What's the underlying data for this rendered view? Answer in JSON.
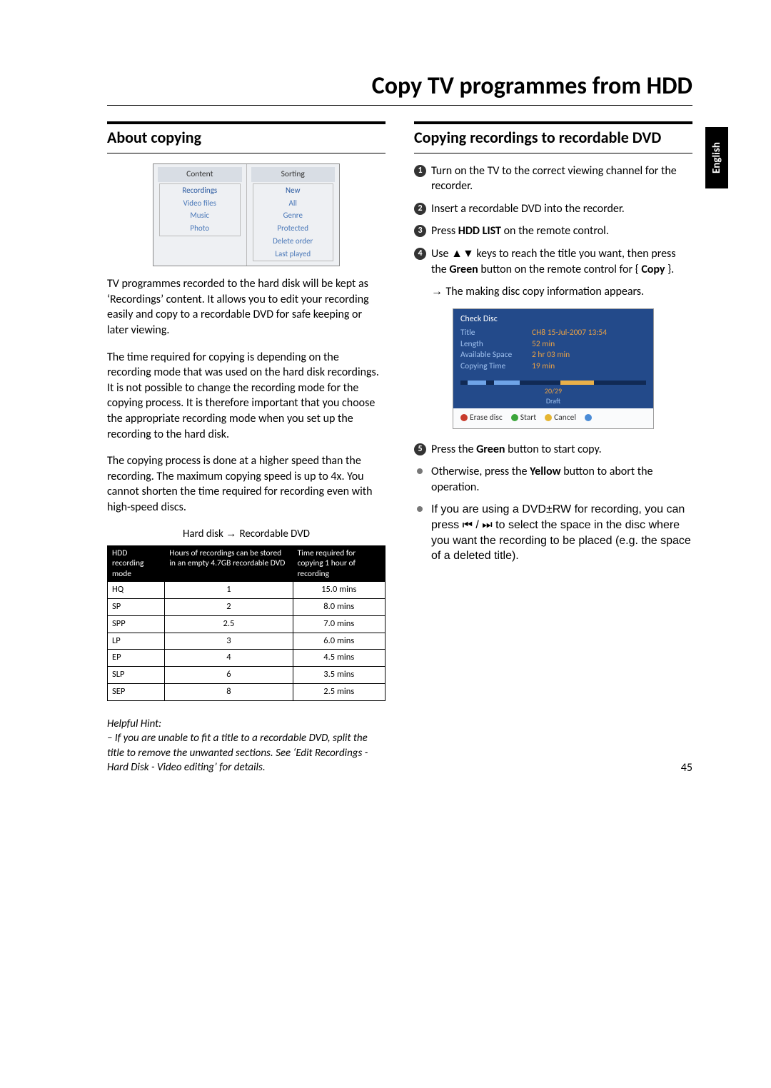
{
  "page_title": "Copy TV programmes from HDD",
  "language_tab": "English",
  "page_number": "45",
  "left": {
    "heading": "About copying",
    "menu_screenshot": {
      "headers": [
        "Content",
        "Sorting"
      ],
      "content_items": [
        "Recordings",
        "Video files",
        "Music",
        "Photo"
      ],
      "sorting_items": [
        "New",
        "All",
        "Genre",
        "Protected",
        "Delete order",
        "Last played"
      ]
    },
    "para1": "TV programmes recorded to the hard disk will be kept as ‘Recordings’ content. It allows you to edit your recording easily and copy to a recordable DVD for safe keeping or later viewing.",
    "para2": "The time required for copying is depending on the recording mode that was used on the hard disk recordings.  It is not possible to change the recording mode for the copying process. It is therefore important that you choose the appropriate recording mode when you set up the recording to the hard disk.",
    "para3": "The copying process is done at a higher speed than the recording. The maximum copying speed is up to 4x.  You cannot shorten the time required for recording even with high-speed discs.",
    "table_caption_a": "Hard disk",
    "table_caption_b": "Recordable DVD",
    "table": {
      "headers": [
        "HDD recording mode",
        "Hours of recordings can be stored in an empty 4.7GB recordable DVD",
        "Time required for copying 1 hour of recording"
      ],
      "rows": [
        [
          "HQ",
          "1",
          "15.0 mins"
        ],
        [
          "SP",
          "2",
          "8.0 mins"
        ],
        [
          "SPP",
          "2.5",
          "7.0 mins"
        ],
        [
          "LP",
          "3",
          "6.0 mins"
        ],
        [
          "EP",
          "4",
          "4.5 mins"
        ],
        [
          "SLP",
          "6",
          "3.5 mins"
        ],
        [
          "SEP",
          "8",
          "2.5 mins"
        ]
      ]
    },
    "hint_label": "Helpful Hint:",
    "hint_body": "– If you are unable to fit a title to a recordable DVD, split the title to remove the unwanted sections. See ‘Edit Recordings - Hard Disk - Video editing’ for details."
  },
  "right": {
    "heading": "Copying recordings to recordable DVD",
    "step1": "Turn on the TV to the correct viewing channel for the recorder.",
    "step2": "Insert a recordable DVD into the recorder.",
    "step3_a": "Press ",
    "step3_bold": "HDD LIST",
    "step3_b": " on the remote control.",
    "step4_a": "Use  ▲▼  keys to reach the title you want, then press the ",
    "step4_bold1": "Green",
    "step4_b": " button on the remote control for { ",
    "step4_bold2": "Copy",
    "step4_c": " }.",
    "step4_sub": "The making disc copy information appears.",
    "checkdisc": {
      "title": "Check Disc",
      "rows": [
        [
          "Title",
          "CH8 15-Jul-2007 13:54"
        ],
        [
          "Length",
          "52 min"
        ],
        [
          "Available Space",
          "2 hr 03 min"
        ],
        [
          "Copying Time",
          "19 min"
        ]
      ],
      "bar_label": "20/29",
      "bar_label2": "Draft",
      "legend": [
        "Erase disc",
        "Start",
        "Cancel"
      ]
    },
    "step5_a": "Press the ",
    "step5_bold": "Green",
    "step5_b": " button to start copy.",
    "bullet1_a": "Otherwise, press the ",
    "bullet1_bold": "Yellow",
    "bullet1_b": " button to abort the operation.",
    "bullet2": "If you are using a DVD±RW for recording, you can press  ⏮ / ⏭  to select the space in the disc where you want the recording to be placed (e.g. the space of a deleted title)."
  },
  "chart_data": {
    "type": "table",
    "title": "Hard disk → Recordable DVD",
    "columns": [
      "HDD recording mode",
      "Hours of recordings can be stored in an empty 4.7GB recordable DVD",
      "Time required for copying 1 hour of recording"
    ],
    "rows": [
      {
        "mode": "HQ",
        "hours": 1,
        "copy_time_mins": 15.0
      },
      {
        "mode": "SP",
        "hours": 2,
        "copy_time_mins": 8.0
      },
      {
        "mode": "SPP",
        "hours": 2.5,
        "copy_time_mins": 7.0
      },
      {
        "mode": "LP",
        "hours": 3,
        "copy_time_mins": 6.0
      },
      {
        "mode": "EP",
        "hours": 4,
        "copy_time_mins": 4.5
      },
      {
        "mode": "SLP",
        "hours": 6,
        "copy_time_mins": 3.5
      },
      {
        "mode": "SEP",
        "hours": 8,
        "copy_time_mins": 2.5
      }
    ]
  }
}
